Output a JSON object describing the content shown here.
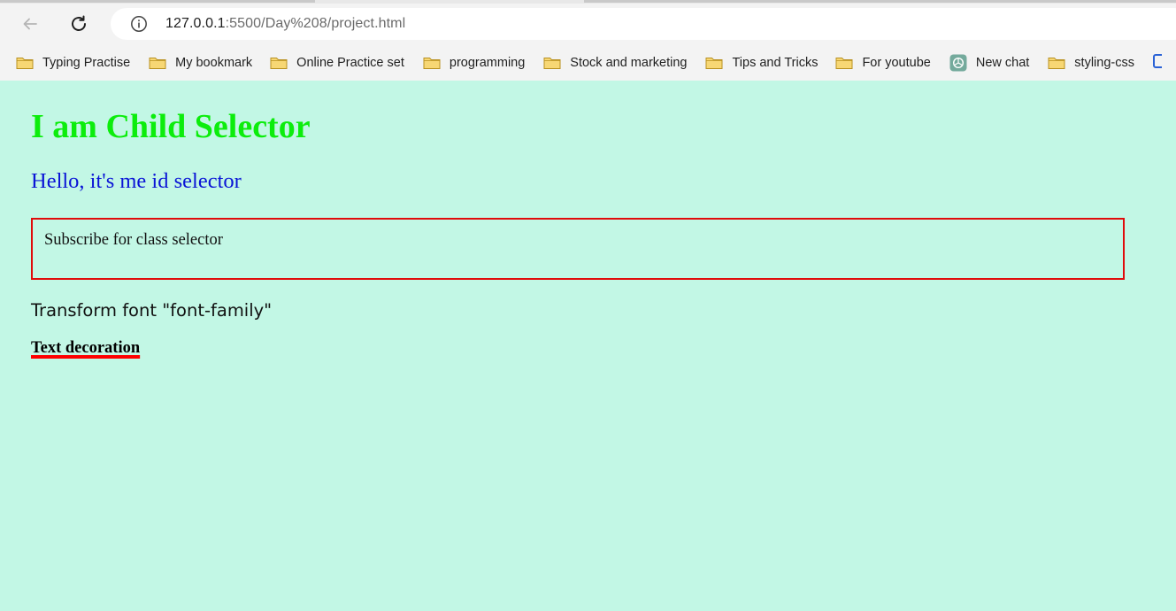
{
  "address_bar": {
    "host": "127.0.0.1",
    "rest": ":5500/Day%208/project.html"
  },
  "bookmarks": [
    {
      "label": "Typing Practise",
      "icon": "folder-icon"
    },
    {
      "label": "My bookmark",
      "icon": "folder-icon"
    },
    {
      "label": "Online Practice set",
      "icon": "folder-icon"
    },
    {
      "label": "programming",
      "icon": "folder-icon"
    },
    {
      "label": "Stock and marketing",
      "icon": "folder-icon"
    },
    {
      "label": "Tips and Tricks",
      "icon": "folder-icon"
    },
    {
      "label": "For youtube",
      "icon": "folder-icon"
    },
    {
      "label": "New chat",
      "icon": "chatgpt-icon"
    },
    {
      "label": "styling-css",
      "icon": "folder-icon"
    }
  ],
  "page": {
    "heading": "I am Child Selector",
    "id_selector_text": "Hello, it's me id selector",
    "class_selector_text": "Subscribe for class selector",
    "font_family_text": "Transform font \"font-family\"",
    "text_decoration_text": "Text decoration"
  },
  "colors": {
    "page_background": "#c2f7e5",
    "heading": "#0ced0c",
    "id_selector": "#0a14d6",
    "class_border": "#e00b0b",
    "underline": "#ff0000",
    "folder_fill": "#f7d774",
    "folder_stroke": "#b8901f"
  }
}
